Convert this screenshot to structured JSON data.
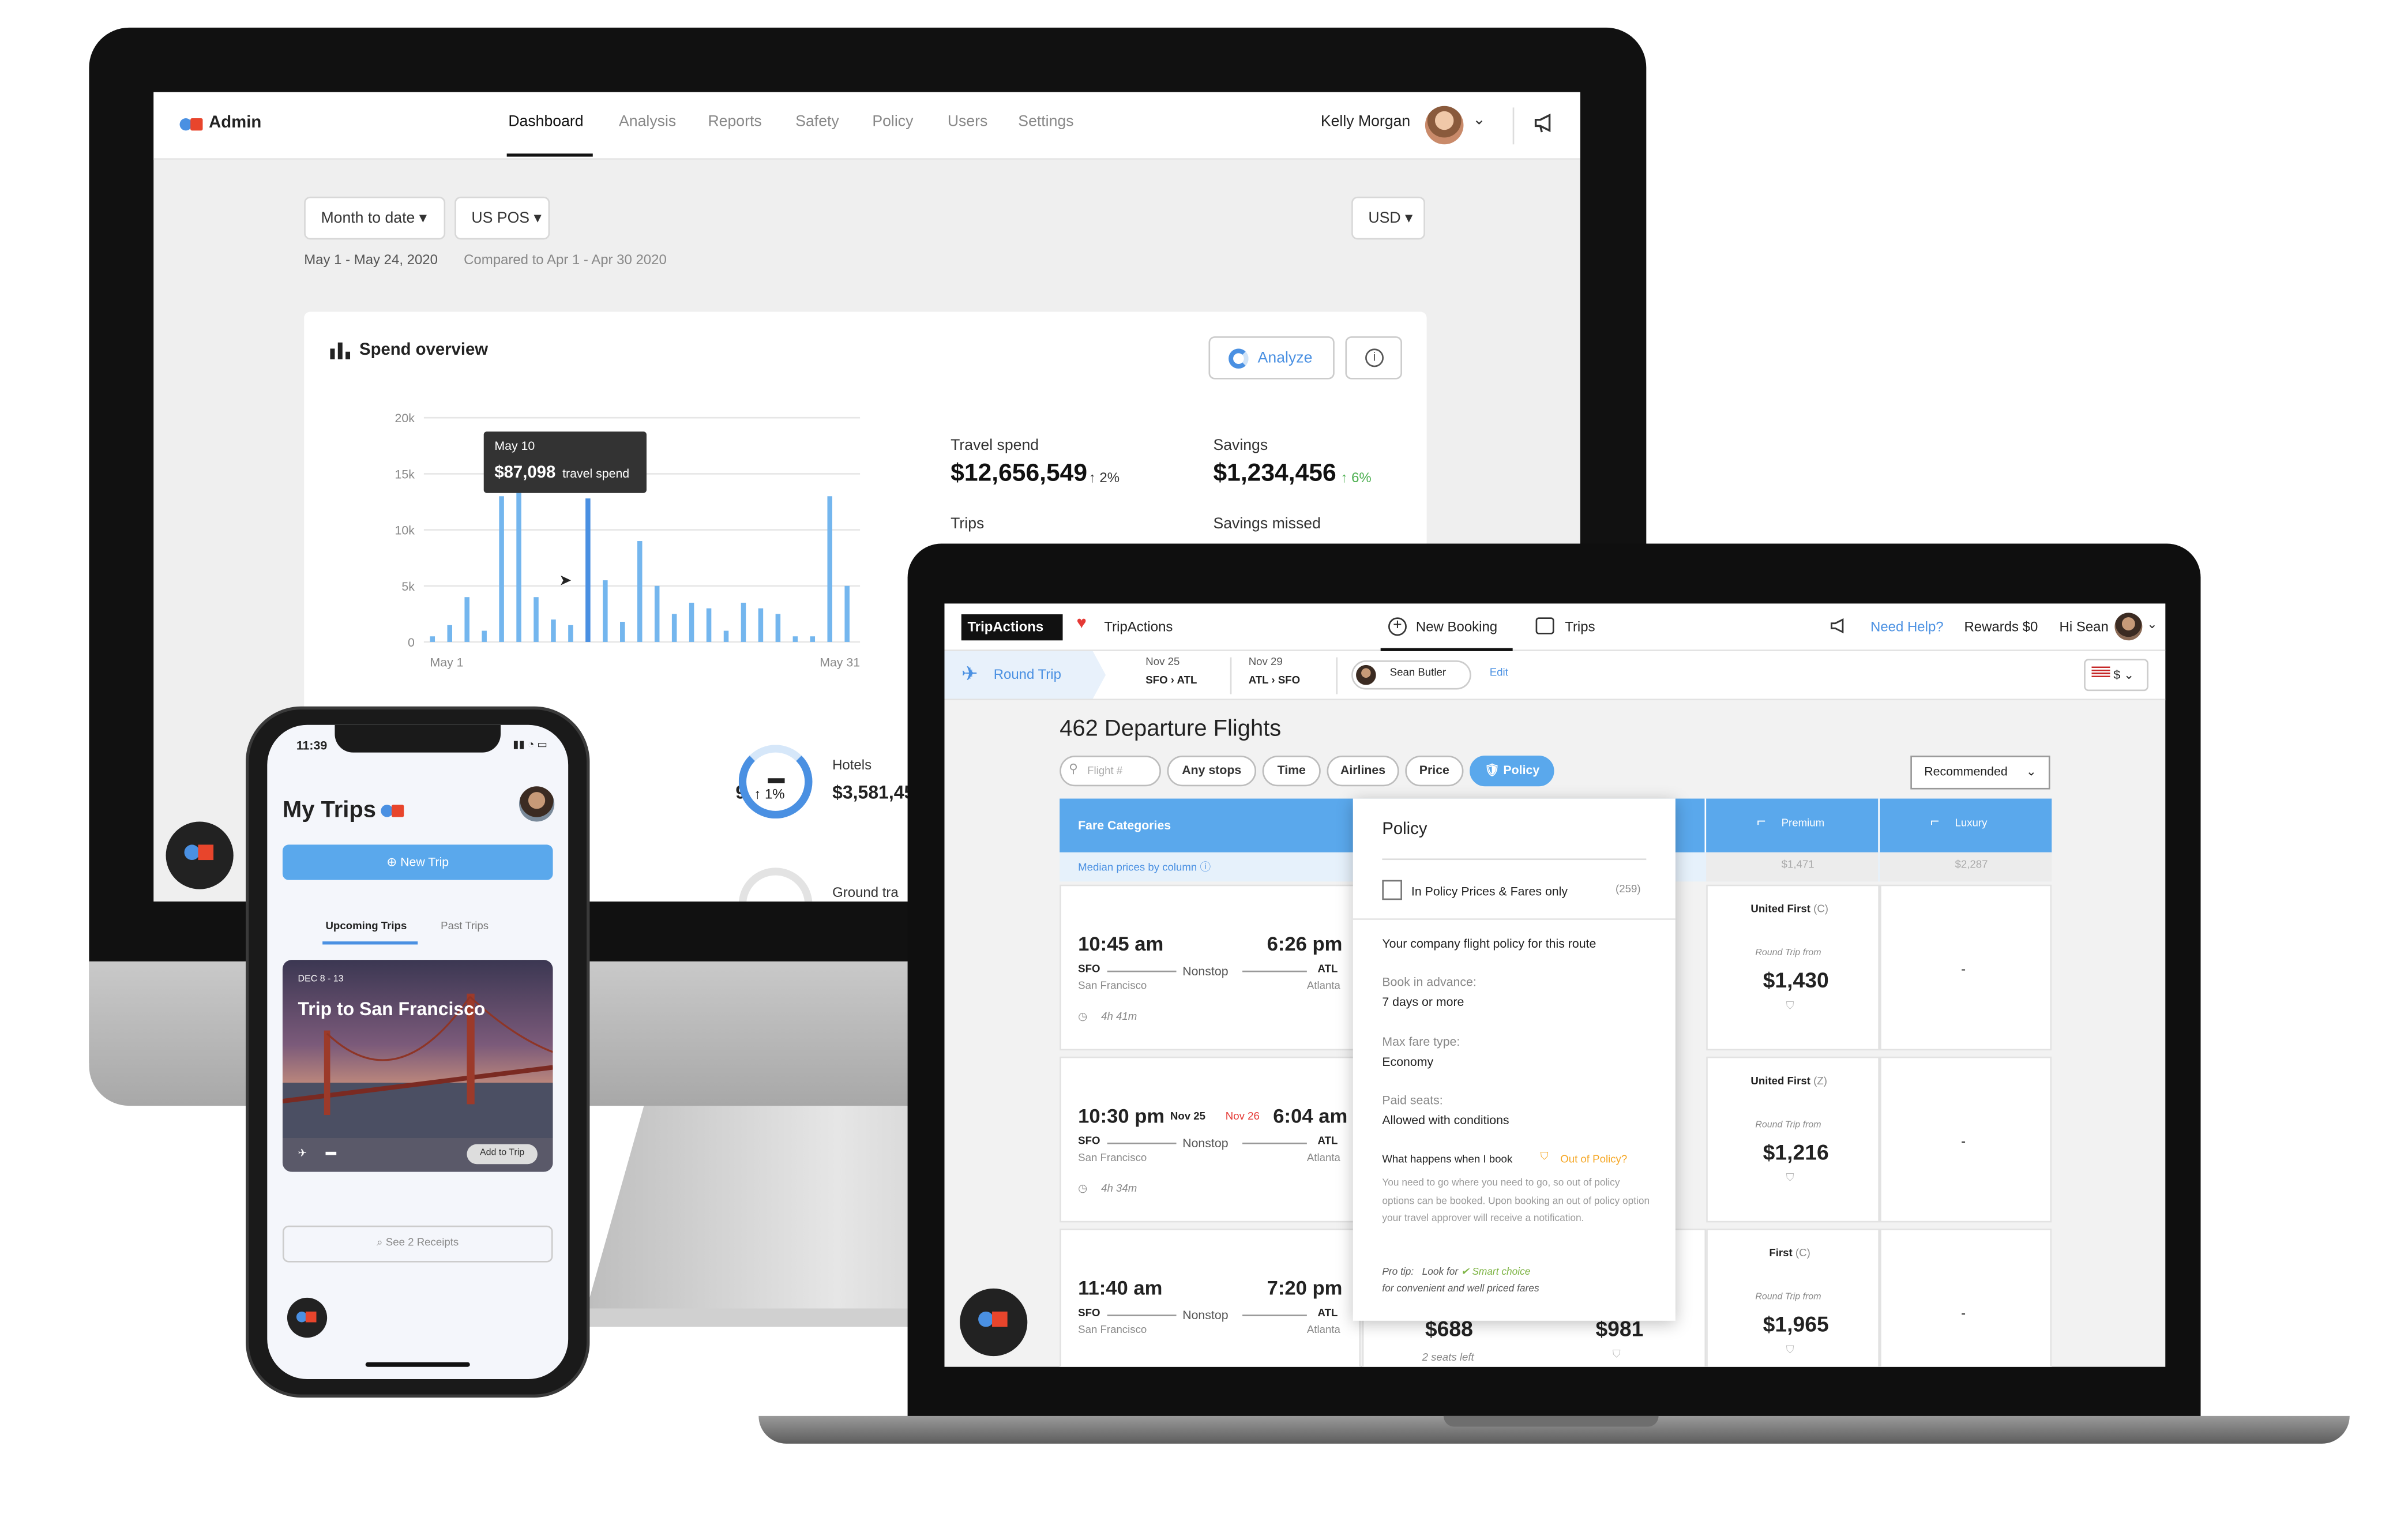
{
  "admin": {
    "brand": "Admin",
    "nav": [
      "Dashboard",
      "Analysis",
      "Reports",
      "Safety",
      "Policy",
      "Users",
      "Settings"
    ],
    "active_nav": "Dashboard",
    "user_name": "Kelly Morgan",
    "filters": {
      "period": "Month to date",
      "pos": "US POS",
      "currency": "USD"
    },
    "date_range": "May 1 - May 24, 2020",
    "compare_text": "Compared to Apr 1 - Apr 30 2020",
    "spend_overview": {
      "title": "Spend overview",
      "analyze_label": "Analyze",
      "tooltip": {
        "date": "May 10",
        "value": "$87,098",
        "suffix": "travel spend"
      },
      "stats": {
        "travel_spend_label": "Travel spend",
        "travel_spend": "$12,656,549",
        "travel_spend_delta": "↑ 2%",
        "savings_label": "Savings",
        "savings": "$1,234,456",
        "savings_delta": "↑ 6%",
        "trips_label": "Trips",
        "savings_missed_label": "Savings missed"
      },
      "partial": {
        "left_value": "9",
        "left_delta": "↑ 1%",
        "hotels_label": "Hotels",
        "hotels_value": "$3,581,45",
        "ground_label": "Ground tra"
      }
    },
    "chart_data": {
      "type": "bar",
      "yticks": [
        "20k",
        "15k",
        "10k",
        "5k",
        "0"
      ],
      "ylim": [
        0,
        20000
      ],
      "x_start_label": "May 1",
      "x_end_label": "May 31",
      "highlight_index": 9,
      "values": [
        500,
        1500,
        4000,
        1000,
        13000,
        16000,
        4000,
        2000,
        1500,
        12800,
        5500,
        1800,
        9000,
        5000,
        2500,
        3500,
        3000,
        1000,
        3500,
        3000,
        2500,
        500,
        500,
        13000,
        5000
      ]
    },
    "colors": {
      "bar": "#74b6ee",
      "bar_highlight": "#4a90e2",
      "accent_green": "#4caf50"
    }
  },
  "booking": {
    "logo_text": "TripActions",
    "company": "TripActions",
    "nav": {
      "new_booking": "New Booking",
      "trips": "Trips"
    },
    "help": "Need Help?",
    "rewards": "Rewards $0",
    "greeting": "Hi Sean",
    "trip_type": "Round Trip",
    "leg1": {
      "date": "Nov 25",
      "route_from": "SFO",
      "route_to": "ATL"
    },
    "leg2": {
      "date": "Nov 29",
      "route_from": "ATL",
      "route_to": "SFO"
    },
    "traveler": "Sean Butler",
    "edit": "Edit",
    "currency": "$",
    "heading": "462 Departure Flights",
    "search_placeholder": "Flight #",
    "chips": [
      "Any stops",
      "Time",
      "Airlines",
      "Price",
      "Policy"
    ],
    "sort": "Recommended",
    "table": {
      "fare_categories": "Fare Categories",
      "median_note": "Median prices by column",
      "premium": "Premium",
      "luxury": "Luxury",
      "premium_median": "$1,471",
      "luxury_median": "$2,287"
    },
    "flights": [
      {
        "depart": "10:45 am",
        "arrive": "6:26 pm",
        "from": "SFO",
        "to": "ATL",
        "from_city": "San Francisco",
        "to_city": "Atlanta",
        "stops": "Nonstop",
        "duration": "4h 41m",
        "premium_fare": "United First",
        "premium_class": "(C)",
        "premium_label": "Round Trip from",
        "premium_price": "$1,430",
        "luxury": "-"
      },
      {
        "depart": "10:30 pm",
        "depart_date": "Nov 25",
        "arrive_date": "Nov 26",
        "arrive": "6:04 am",
        "from": "SFO",
        "to": "ATL",
        "from_city": "San Francisco",
        "to_city": "Atlanta",
        "stops": "Nonstop",
        "duration": "4h 34m",
        "premium_fare": "United First",
        "premium_class": "(Z)",
        "premium_label": "Round Trip from",
        "premium_price": "$1,216",
        "luxury": "-"
      },
      {
        "depart": "11:40 am",
        "arrive": "7:20 pm",
        "from": "SFO",
        "to": "ATL",
        "from_city": "San Francisco",
        "to_city": "Atlanta",
        "stops": "Nonstop",
        "price_a": "$688",
        "price_b": "$981",
        "seats_left": "2 seats left",
        "premium_fare": "First",
        "premium_class": "(C)",
        "premium_label": "Round Trip from",
        "premium_price": "$1,965",
        "luxury": "-"
      }
    ],
    "policy": {
      "title": "Policy",
      "checkbox_label": "In Policy Prices & Fares only",
      "checkbox_count": "(259)",
      "subtitle": "Your company flight policy for this route",
      "advance_label": "Book in advance:",
      "advance_value": "7 days or more",
      "fare_label": "Max fare type:",
      "fare_value": "Economy",
      "seats_label": "Paid seats:",
      "seats_value": "Allowed with conditions",
      "what_label": "What happens when I book",
      "oop_label": "Out of Policy?",
      "oop_text": "You need to go where you need to go, so out of policy options can be booked. Upon booking an out of policy option your travel approver will receive a notification.",
      "pro_tip": "Pro tip:",
      "look_for": "Look for",
      "smart_choice": "Smart choice",
      "pro_tip_rest": "for convenient and well priced fares"
    }
  },
  "phone": {
    "time": "11:39",
    "title": "My Trips",
    "new_trip": "New Trip",
    "tabs": [
      "Upcoming Trips",
      "Past Trips"
    ],
    "trip": {
      "dates": "DEC 8 - 13",
      "name": "Trip to San Francisco",
      "add_label": "Add to Trip"
    },
    "receipts": "See 2 Receipts"
  }
}
